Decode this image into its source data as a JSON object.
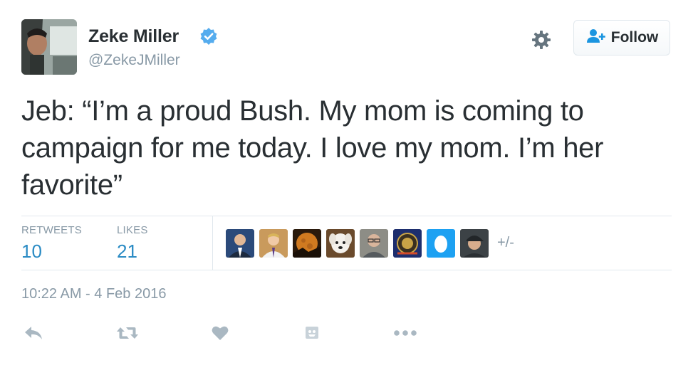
{
  "header": {
    "display_name": "Zeke Miller",
    "handle": "@ZekeJMiller",
    "follow_label": "Follow",
    "icons": {
      "verified": "verified-badge-icon",
      "settings": "gear-icon",
      "follow": "add-user-icon"
    }
  },
  "tweet": {
    "text": "Jeb: “I’m a proud Bush. My mom is coming to campaign for me today. I love my mom. I’m her favorite”"
  },
  "stats": {
    "retweets_label": "RETWEETS",
    "retweets_count": "10",
    "likes_label": "LIKES",
    "likes_count": "21",
    "more_label": "+/-",
    "liker_avatars": [
      "avatar-man-suit",
      "avatar-man-tie",
      "avatar-moon",
      "avatar-dog",
      "avatar-man-glasses",
      "avatar-badge",
      "avatar-default-egg",
      "avatar-man-cap"
    ]
  },
  "timestamp": "10:22 AM - 4 Feb 2016",
  "actions": [
    "reply-icon",
    "retweet-icon",
    "like-icon",
    "gif-icon",
    "more-icon"
  ],
  "colors": {
    "link": "#2a8bc4",
    "muted": "#8899a6",
    "verified": "#55acee",
    "text": "#292f33",
    "border": "#e1e8ed"
  }
}
